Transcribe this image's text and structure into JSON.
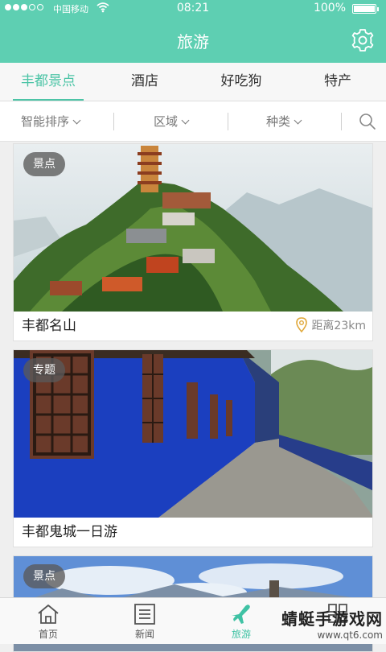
{
  "status_bar": {
    "carrier": "中国移动",
    "time": "08:21",
    "battery": "100%"
  },
  "header": {
    "title": "旅游",
    "settings_icon": "gear-icon"
  },
  "tabs": [
    {
      "label": "丰都景点",
      "active": true
    },
    {
      "label": "酒店",
      "active": false
    },
    {
      "label": "好吃狗",
      "active": false
    },
    {
      "label": "特产",
      "active": false
    }
  ],
  "filters": [
    {
      "label": "智能排序"
    },
    {
      "label": "区域"
    },
    {
      "label": "种类"
    }
  ],
  "search_icon": "search-icon",
  "cards": [
    {
      "tag": "景点",
      "name": "丰都名山",
      "distance": "距离23km"
    },
    {
      "tag": "专题",
      "name": "丰都鬼城一日游",
      "distance": ""
    },
    {
      "tag": "景点",
      "name": "",
      "distance": ""
    }
  ],
  "bottom_nav": [
    {
      "label": "首页",
      "icon": "home-icon",
      "active": false
    },
    {
      "label": "新闻",
      "icon": "news-icon",
      "active": false
    },
    {
      "label": "旅游",
      "icon": "plane-icon",
      "active": true
    },
    {
      "label": "",
      "icon": "grid-icon",
      "active": false
    }
  ],
  "watermark": {
    "line1": "蜻蜓手游戏网",
    "line2": "www.qt6.com"
  },
  "colors": {
    "accent": "#5ecfb2",
    "tab_active": "#4cc4a6"
  }
}
